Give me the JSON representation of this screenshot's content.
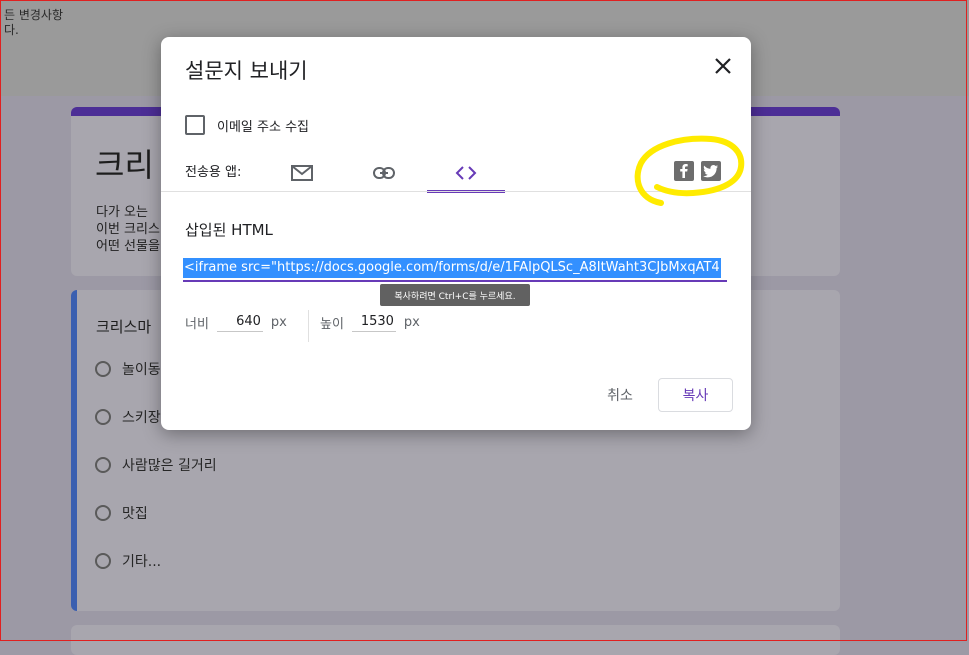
{
  "background": {
    "top_note": "든 변경사항\n다.",
    "form_title": "크리",
    "form_description": "다가 오는\n이번 크리스\n어떤 선물을",
    "question_title": "크리스마",
    "options": [
      "놀이동",
      "스키장",
      "사람많은 길거리",
      "맛집",
      "기타..."
    ]
  },
  "dialog": {
    "title": "설문지 보내기",
    "collect_email_label": "이메일 주소 수집",
    "send_via_label": "전송용 앱:",
    "tabs": [
      {
        "name": "email",
        "icon": "mail-icon"
      },
      {
        "name": "link",
        "icon": "link-icon"
      },
      {
        "name": "embed",
        "icon": "code-icon",
        "active": true
      }
    ],
    "social": [
      {
        "icon": "facebook-icon"
      },
      {
        "icon": "twitter-icon"
      }
    ],
    "embed_label": "삽입된 HTML",
    "embed_code": "<iframe src=\"https://docs.google.com/forms/d/e/1FAIpQLSc_A8ItWaht3CJbMxqAT4",
    "tooltip": "복사하려면 Ctrl+C를 누르세요.",
    "width_label": "너비",
    "width_value": "640",
    "height_label": "높이",
    "height_value": "1530",
    "unit": "px",
    "cancel_label": "취소",
    "copy_label": "복사"
  },
  "colors": {
    "accent": "#673ab7",
    "selection": "#3390ff",
    "highlight_marker": "#ffeb00"
  }
}
